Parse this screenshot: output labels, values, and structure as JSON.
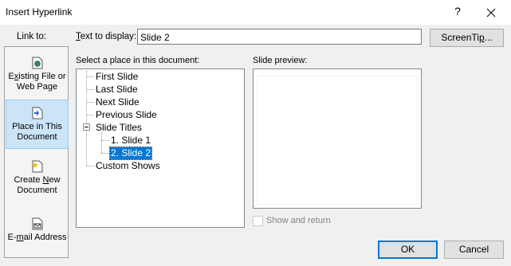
{
  "window": {
    "title": "Insert Hyperlink",
    "help_glyph": "?"
  },
  "sidebar": {
    "heading": "Link to:",
    "items": [
      {
        "line1": "E",
        "line1_ul": "x",
        "line1_rest": "isting File or",
        "line2": "Web Page",
        "icon": "existing-file-icon"
      },
      {
        "line1": "Place in This",
        "line1_ul": "",
        "line1_rest": "",
        "line2": "Document",
        "icon": "place-in-document-icon"
      },
      {
        "line1": "Create ",
        "line1_ul": "N",
        "line1_rest": "ew",
        "line2": "Document",
        "icon": "create-new-document-icon"
      },
      {
        "line1": "E-",
        "line1_ul": "m",
        "line1_rest": "ail Address",
        "line2": "",
        "icon": "email-address-icon"
      }
    ]
  },
  "text_to_display": {
    "label_ul": "T",
    "label_rest": "ext to display:",
    "value": "Slide 2"
  },
  "screentip": {
    "pre": "ScreenTi",
    "ul": "p",
    "post": "..."
  },
  "place_label": "Select a place in this document:",
  "tree": {
    "items": [
      {
        "label": "First Slide"
      },
      {
        "label": "Last Slide"
      },
      {
        "label": "Next Slide"
      },
      {
        "label": "Previous Slide"
      },
      {
        "label": "Slide Titles"
      },
      {
        "label": "1. Slide 1"
      },
      {
        "label": "2. Slide 2"
      },
      {
        "label": "Custom Shows"
      }
    ]
  },
  "preview_label": "Slide preview:",
  "show_and_return": "Show and return",
  "buttons": {
    "ok": "OK",
    "cancel": "Cancel"
  },
  "colors": {
    "selection": "#0078d7",
    "sidebar_selected": "#cce4f7"
  }
}
